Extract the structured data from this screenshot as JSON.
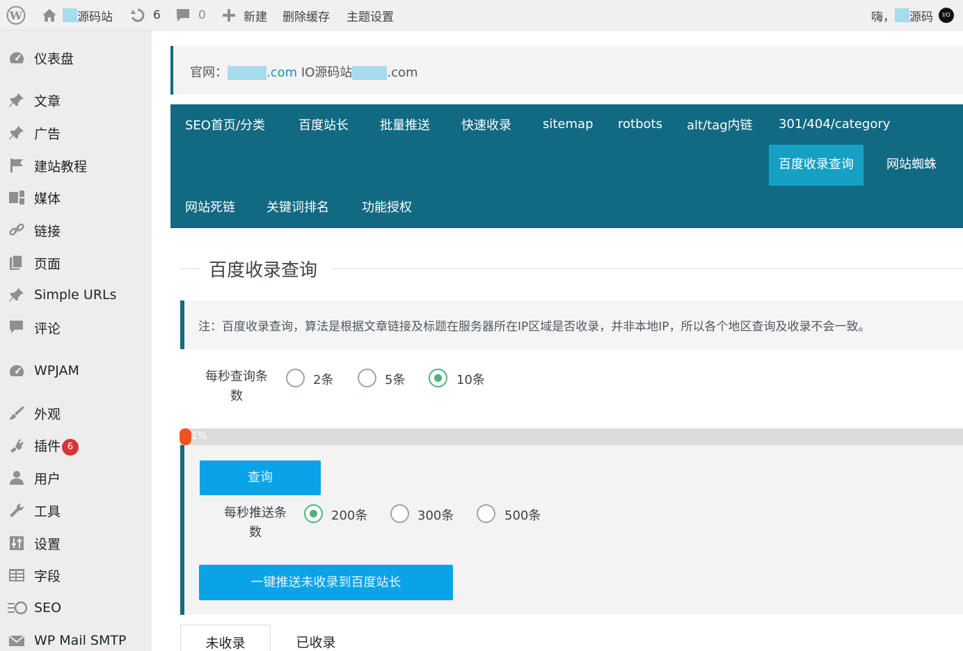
{
  "adminbar": {
    "site_name": "源码站",
    "updates_count": "6",
    "comments_count": "0",
    "new_label": "新建",
    "clear_cache_label": "删除缓存",
    "theme_settings_label": "主题设置",
    "greeting": "嗨，",
    "user_name": "源码",
    "avatar_text": "I/O"
  },
  "sidebar": {
    "items": [
      {
        "label": "仪表盘",
        "icon": "dashboard-icon"
      },
      {
        "label": "文章",
        "icon": "pin-icon"
      },
      {
        "label": "广告",
        "icon": "pin-icon"
      },
      {
        "label": "建站教程",
        "icon": "flag-icon"
      },
      {
        "label": "媒体",
        "icon": "media-icon"
      },
      {
        "label": "链接",
        "icon": "link-icon"
      },
      {
        "label": "页面",
        "icon": "page-icon"
      },
      {
        "label": "Simple URLs",
        "icon": "pin-icon"
      },
      {
        "label": "评论",
        "icon": "comment-icon"
      },
      {
        "label": "WPJAM",
        "icon": "dashboard-icon"
      },
      {
        "label": "外观",
        "icon": "brush-icon"
      },
      {
        "label": "插件",
        "icon": "plugin-icon",
        "badge": "6"
      },
      {
        "label": "用户",
        "icon": "user-icon"
      },
      {
        "label": "工具",
        "icon": "wrench-icon"
      },
      {
        "label": "设置",
        "icon": "settings-icon"
      },
      {
        "label": "字段",
        "icon": "table-icon"
      },
      {
        "label": "SEO",
        "icon": "seo-icon"
      },
      {
        "label": "WP Mail SMTP",
        "icon": "mail-icon"
      }
    ]
  },
  "official": {
    "prefix": "官网：",
    "domain1_suffix": ".com",
    "middle": "IO源码站",
    "domain2_suffix": ".com"
  },
  "nav": {
    "tabs": [
      "SEO首页/分类",
      "百度站长",
      "批量推送",
      "快速收录",
      "sitemap",
      "rotbots",
      "alt/tag内链",
      "301/404/category",
      "百度收录查询",
      "网站蜘蛛",
      "网站死链",
      "关键词排名",
      "功能授权"
    ],
    "active": "百度收录查询"
  },
  "section": {
    "title": "百度收录查询",
    "notice": "注：百度收录查询，算法是根据文章链接及标题在服务器所在IP区域是否收录，并非本地IP，所以各个地区查询及收录不会一致。"
  },
  "query_rate": {
    "label_line1": "每秒查询条",
    "label_line2": "数",
    "options": [
      "2条",
      "5条",
      "10条"
    ],
    "selected": "10条"
  },
  "progress": {
    "percent_text": "1%",
    "value": 0.01
  },
  "push": {
    "query_button": "查询",
    "label_line1": "每秒推送条",
    "label_line2": "数",
    "options": [
      "200条",
      "300条",
      "500条"
    ],
    "selected": "200条",
    "push_button": "一键推送未收录到百度站长"
  },
  "result_tabs": {
    "tabs": [
      "未收录",
      "已收录"
    ],
    "active": "未收录"
  }
}
